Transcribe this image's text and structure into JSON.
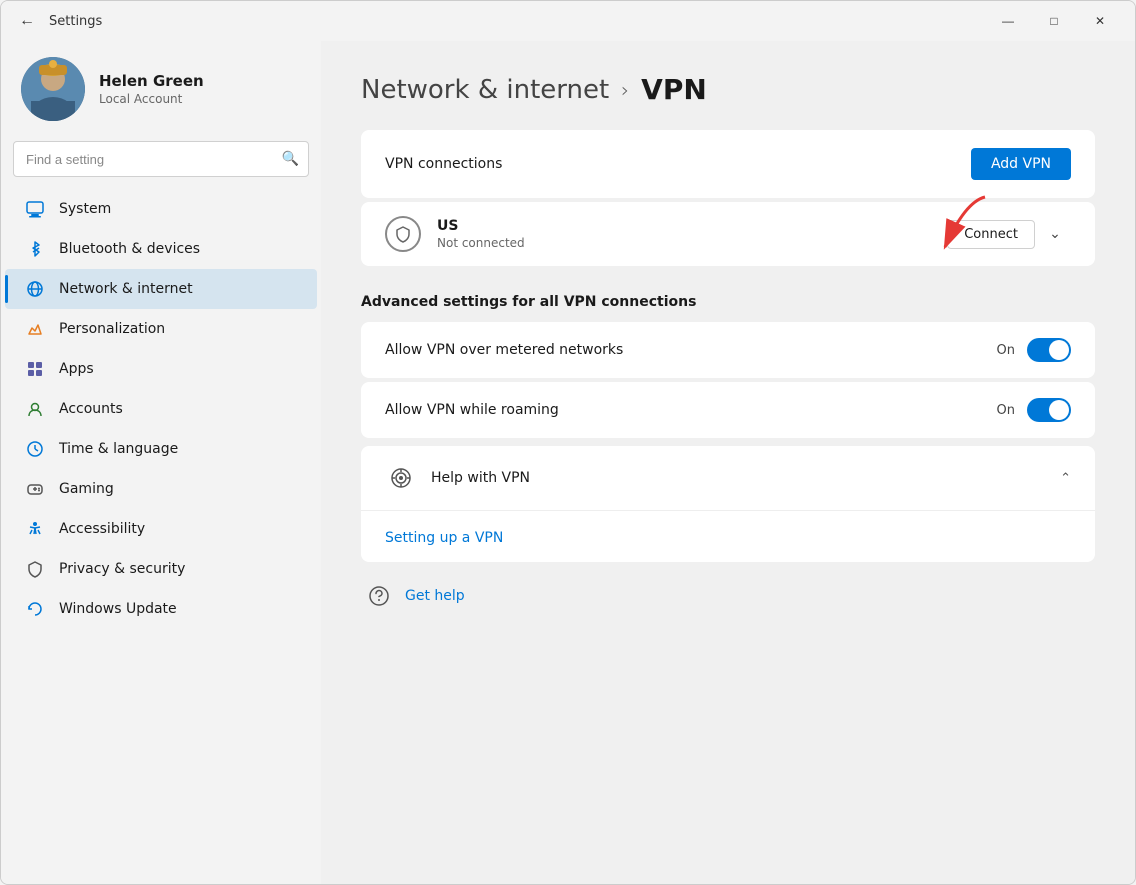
{
  "window": {
    "title": "Settings",
    "controls": {
      "minimize": "—",
      "maximize": "□",
      "close": "✕"
    }
  },
  "user": {
    "name": "Helen Green",
    "account_type": "Local Account"
  },
  "search": {
    "placeholder": "Find a setting"
  },
  "nav": {
    "items": [
      {
        "id": "system",
        "label": "System",
        "icon": "💻"
      },
      {
        "id": "bluetooth",
        "label": "Bluetooth & devices",
        "icon": "🔵"
      },
      {
        "id": "network",
        "label": "Network & internet",
        "icon": "🌐",
        "active": true
      },
      {
        "id": "personalization",
        "label": "Personalization",
        "icon": "✏️"
      },
      {
        "id": "apps",
        "label": "Apps",
        "icon": "📦"
      },
      {
        "id": "accounts",
        "label": "Accounts",
        "icon": "👤"
      },
      {
        "id": "time",
        "label": "Time & language",
        "icon": "🌍"
      },
      {
        "id": "gaming",
        "label": "Gaming",
        "icon": "🎮"
      },
      {
        "id": "accessibility",
        "label": "Accessibility",
        "icon": "♿"
      },
      {
        "id": "privacy",
        "label": "Privacy & security",
        "icon": "🛡️"
      },
      {
        "id": "update",
        "label": "Windows Update",
        "icon": "🔄"
      }
    ]
  },
  "page": {
    "breadcrumb_parent": "Network & internet",
    "breadcrumb_sep": "›",
    "title": "VPN",
    "vpn_connections_label": "VPN connections",
    "add_vpn_label": "Add VPN",
    "vpn_entry": {
      "name": "US",
      "status": "Not connected",
      "connect_label": "Connect"
    },
    "advanced_section_title": "Advanced settings for all VPN connections",
    "toggle_rows": [
      {
        "label": "Allow VPN over metered networks",
        "status": "On",
        "enabled": true
      },
      {
        "label": "Allow VPN while roaming",
        "status": "On",
        "enabled": true
      }
    ],
    "help_section": {
      "label": "Help with VPN",
      "link_label": "Setting up a VPN"
    },
    "get_help_label": "Get help"
  }
}
